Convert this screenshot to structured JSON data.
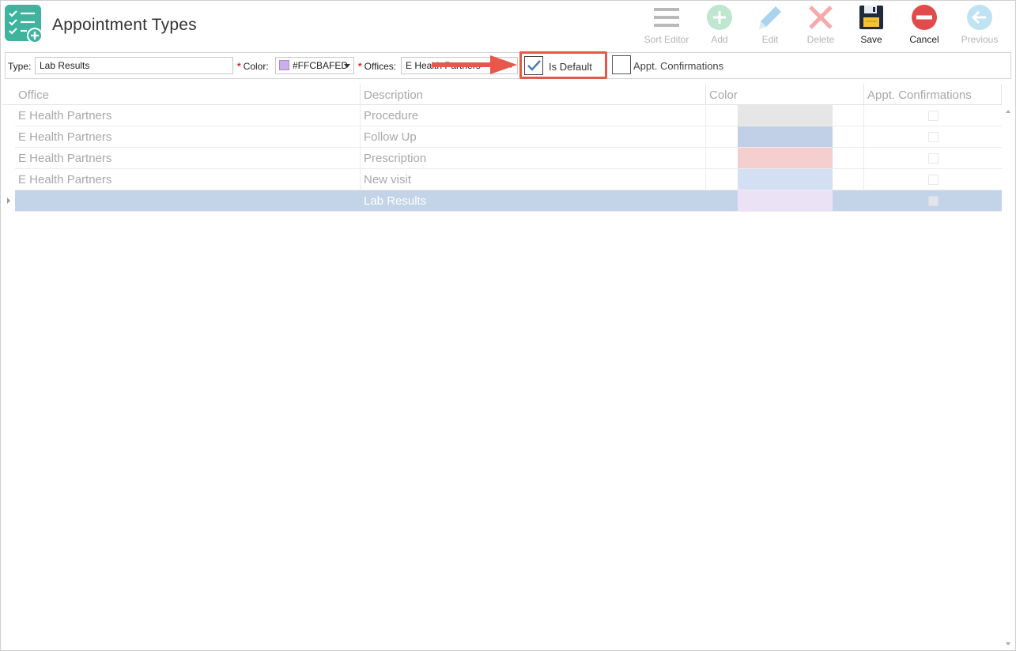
{
  "header": {
    "title": "Appointment Types"
  },
  "toolbar": {
    "sort_editor": "Sort Editor",
    "add": "Add",
    "edit": "Edit",
    "delete": "Delete",
    "save": "Save",
    "cancel": "Cancel",
    "previous": "Previous"
  },
  "filters": {
    "type_label": "Type:",
    "type_value": "Lab Results",
    "color_label": "Color:",
    "color_value": "#FFCBAFED",
    "offices_label": "Offices:",
    "offices_value": "E Health Partners",
    "is_default_label": "Is Default",
    "is_default_checked": true,
    "appt_confirmations_label": "Appt. Confirmations",
    "appt_confirmations_checked": false,
    "required_mark": "*"
  },
  "grid": {
    "columns": [
      "Office",
      "Description",
      "Color",
      "Appt. Confirmations"
    ],
    "rows": [
      {
        "office": "E Health Partners",
        "description": "Procedure",
        "color": "#e6e6e6",
        "confirm": false
      },
      {
        "office": "E Health Partners",
        "description": "Follow Up",
        "color": "#c1d0e6",
        "confirm": false
      },
      {
        "office": "E Health Partners",
        "description": "Prescription",
        "color": "#f5cfcf",
        "confirm": false
      },
      {
        "office": "E Health Partners",
        "description": "New visit",
        "color": "#d3e0f4",
        "confirm": false
      },
      {
        "office": "",
        "description": "Lab Results",
        "color": "#ece2f6",
        "confirm": false,
        "selected": true
      }
    ]
  },
  "colors": {
    "accent_red": "#e5584a",
    "selected_row": "#c3d3e8",
    "app_icon": "#3fb39e"
  }
}
